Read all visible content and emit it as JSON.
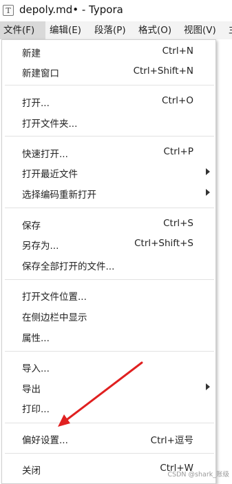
{
  "window": {
    "title": "depoly.md• - Typora",
    "app_icon_glyph": "T",
    "app_icon": "typora-icon"
  },
  "menubar": {
    "items": [
      {
        "label": "文件(F)"
      },
      {
        "label": "编辑(E)"
      },
      {
        "label": "段落(P)"
      },
      {
        "label": "格式(O)"
      },
      {
        "label": "视图(V)"
      },
      {
        "label": "主"
      }
    ]
  },
  "file_menu": {
    "groups": [
      [
        {
          "label": "新建",
          "shortcut": "Ctrl+N"
        },
        {
          "label": "新建窗口",
          "shortcut": "Ctrl+Shift+N"
        }
      ],
      [
        {
          "label": "打开...",
          "shortcut": "Ctrl+O"
        },
        {
          "label": "打开文件夹...",
          "shortcut": ""
        }
      ],
      [
        {
          "label": "快速打开...",
          "shortcut": "Ctrl+P"
        },
        {
          "label": "打开最近文件",
          "shortcut": "",
          "submenu": true
        },
        {
          "label": "选择编码重新打开",
          "shortcut": "",
          "submenu": true
        }
      ],
      [
        {
          "label": "保存",
          "shortcut": "Ctrl+S"
        },
        {
          "label": "另存为...",
          "shortcut": "Ctrl+Shift+S"
        },
        {
          "label": "保存全部打开的文件...",
          "shortcut": ""
        }
      ],
      [
        {
          "label": "打开文件位置...",
          "shortcut": ""
        },
        {
          "label": "在侧边栏中显示",
          "shortcut": ""
        },
        {
          "label": "属性...",
          "shortcut": ""
        }
      ],
      [
        {
          "label": "导入...",
          "shortcut": ""
        },
        {
          "label": "导出",
          "shortcut": "",
          "submenu": true
        },
        {
          "label": "打印...",
          "shortcut": ""
        }
      ],
      [
        {
          "label": "偏好设置...",
          "shortcut": "Ctrl+逗号"
        }
      ],
      [
        {
          "label": "关闭",
          "shortcut": "Ctrl+W"
        }
      ]
    ]
  },
  "annotation": {
    "color": "#e02020",
    "points_to": "偏好设置..."
  },
  "watermark": "CSDN @shark_账级",
  "colors": {
    "menubar_bg": "#f3f3f3",
    "active_menu_bg": "#d9d9d9",
    "separator": "#e2e2e2"
  }
}
